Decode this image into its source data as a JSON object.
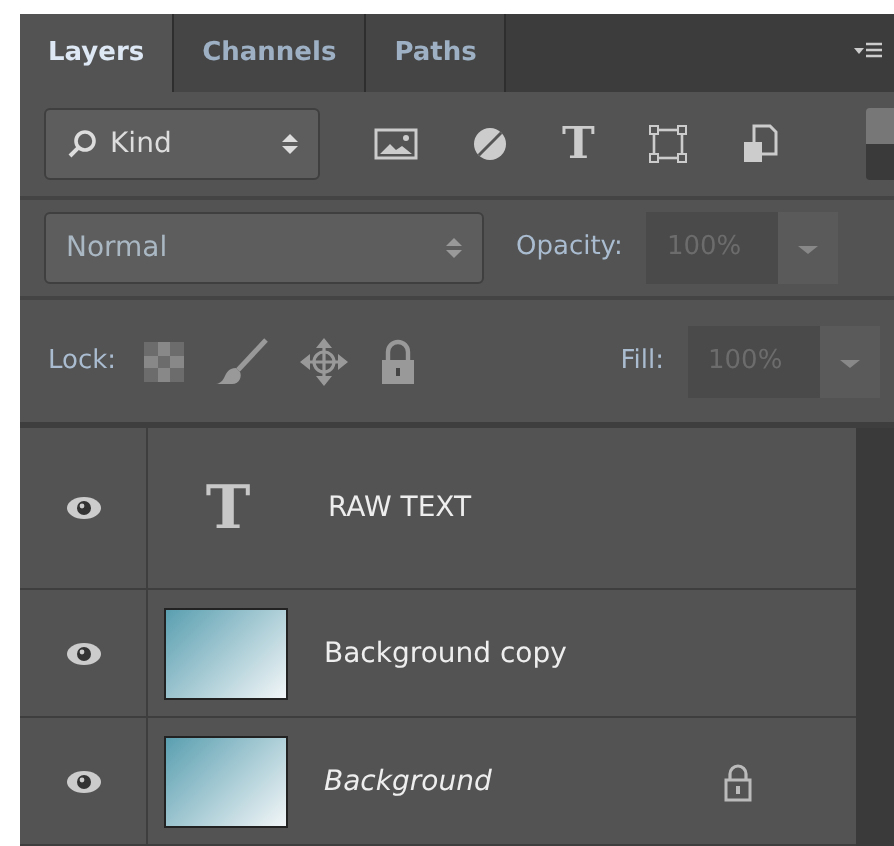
{
  "tabs": [
    {
      "label": "Layers",
      "selected": true
    },
    {
      "label": "Channels",
      "selected": false
    },
    {
      "label": "Paths",
      "selected": false
    }
  ],
  "filter": {
    "label": "Kind",
    "on": true,
    "buttons": [
      {
        "kind": "image"
      },
      {
        "kind": "adjustment"
      },
      {
        "kind": "type",
        "glyph": "T"
      },
      {
        "kind": "shape"
      },
      {
        "kind": "smart"
      }
    ]
  },
  "blend": {
    "mode": "Normal",
    "opacity_label": "Opacity:",
    "opacity": "100%"
  },
  "lock": {
    "label": "Lock:",
    "fill_label": "Fill:",
    "fill": "100%"
  },
  "layers": [
    {
      "kind": "text",
      "glyph": "T",
      "name": "RAW TEXT",
      "visible": true,
      "locked": false
    },
    {
      "kind": "image",
      "name": "Background copy",
      "visible": true,
      "locked": false
    },
    {
      "kind": "image",
      "name": "Background",
      "visible": true,
      "locked": true
    }
  ]
}
